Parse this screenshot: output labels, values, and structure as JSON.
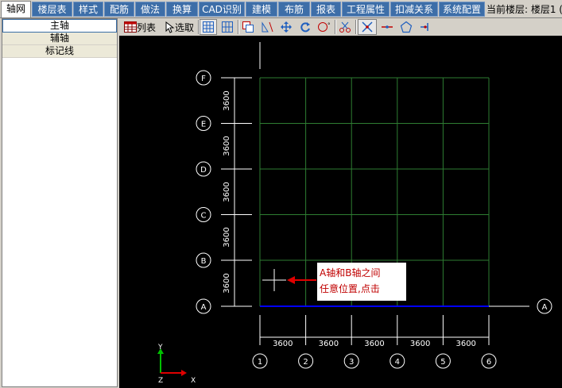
{
  "tabs": [
    {
      "label": "轴网",
      "active": true
    },
    {
      "label": "楼层表"
    },
    {
      "label": "样式"
    },
    {
      "label": "配筋"
    },
    {
      "label": "做法"
    },
    {
      "label": "换算"
    },
    {
      "label": "CAD识别"
    },
    {
      "label": "建模"
    },
    {
      "label": "布筋"
    },
    {
      "label": "报表"
    },
    {
      "label": "工程属性"
    },
    {
      "label": "扣减关系"
    },
    {
      "label": "系统配置"
    }
  ],
  "current_floor": "当前楼层: 楼层1 (",
  "sidebar": {
    "items": [
      {
        "label": "主轴"
      },
      {
        "label": "辅轴"
      },
      {
        "label": "标记线"
      }
    ]
  },
  "toolbar": {
    "list_label": "列表",
    "select_label": "选取"
  },
  "grid": {
    "rows": [
      "A",
      "B",
      "C",
      "D",
      "E",
      "F"
    ],
    "columns": [
      "1",
      "2",
      "3",
      "4",
      "5",
      "6"
    ],
    "column_spacings": [
      "3600",
      "3600",
      "3600",
      "3600",
      "3600"
    ],
    "row_spacings": [
      "3600",
      "3600",
      "3600",
      "3600",
      "3600"
    ],
    "right_label": "A"
  },
  "callout": {
    "line1": "A轴和B轴之间",
    "line2": "任意位置,点击"
  },
  "ucs": {
    "y": "Y",
    "x": "X",
    "z": "Z"
  },
  "colors": {
    "tab_bg": "#3d6ea8",
    "grid_green": "#2e7d32",
    "highlight_blue": "#0000ff",
    "callout_text": "#c00000",
    "arrow_red": "#e00000"
  }
}
